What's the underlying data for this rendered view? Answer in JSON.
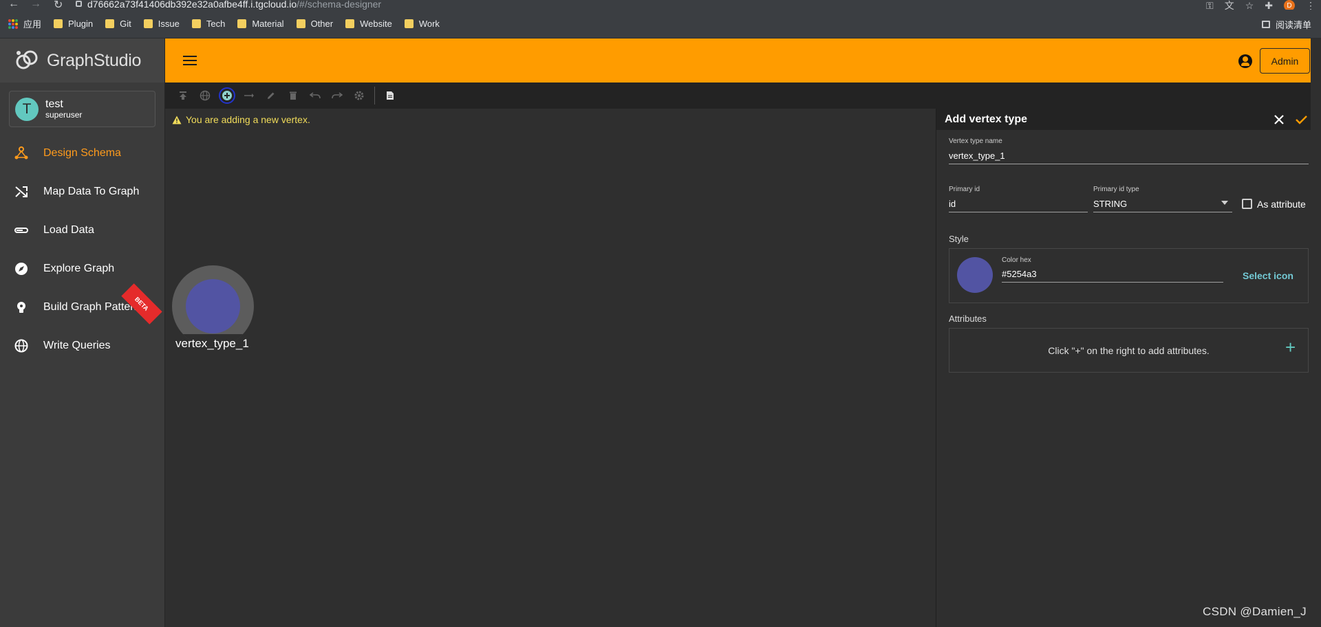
{
  "browser": {
    "url_host": "d76662a73f41406db392e32a0afbe4ff.i.tgcloud.io",
    "url_path": "/#/schema-designer",
    "profile_initial": "D",
    "bookmarks": [
      "应用",
      "Plugin",
      "Git",
      "Issue",
      "Tech",
      "Material",
      "Other",
      "Website",
      "Work"
    ],
    "reading_list": "阅读清单"
  },
  "sidebar": {
    "logo_prefix": "Graph",
    "logo_suffix": "Studio",
    "user": {
      "initial": "T",
      "name": "test",
      "role": "superuser"
    },
    "items": [
      {
        "label": "Design Schema",
        "icon": "schema-icon",
        "active": true
      },
      {
        "label": "Map Data To Graph",
        "icon": "shuffle-icon"
      },
      {
        "label": "Load Data",
        "icon": "progress-icon"
      },
      {
        "label": "Explore Graph",
        "icon": "compass-icon"
      },
      {
        "label": "Build Graph Patterns",
        "icon": "bulb-icon",
        "badge": "BETA"
      },
      {
        "label": "Write Queries",
        "icon": "globe-icon"
      }
    ]
  },
  "appbar": {
    "admin_label": "Admin"
  },
  "canvas": {
    "warning": "You are adding a new vertex.",
    "vertex_label": "vertex_type_1",
    "vertex_color": "#5254a3"
  },
  "panel": {
    "title": "Add vertex type",
    "vertex_type_name_label": "Vertex type name",
    "vertex_type_name": "vertex_type_1",
    "primary_id_label": "Primary id",
    "primary_id": "id",
    "primary_id_type_label": "Primary id type",
    "primary_id_type": "STRING",
    "as_attribute_label": "As attribute",
    "as_attribute_checked": false,
    "style_label": "Style",
    "color_hex_label": "Color hex",
    "color_hex": "#5254a3",
    "select_icon_label": "Select icon",
    "attributes_label": "Attributes",
    "attributes_hint": "Click \"+\" on the right to add attributes."
  },
  "watermark": "CSDN @Damien_J",
  "colors": {
    "accent": "#ff9c00",
    "active_nav": "#ff9b1c",
    "vertex": "#5254a3",
    "link": "#73c9d4"
  }
}
